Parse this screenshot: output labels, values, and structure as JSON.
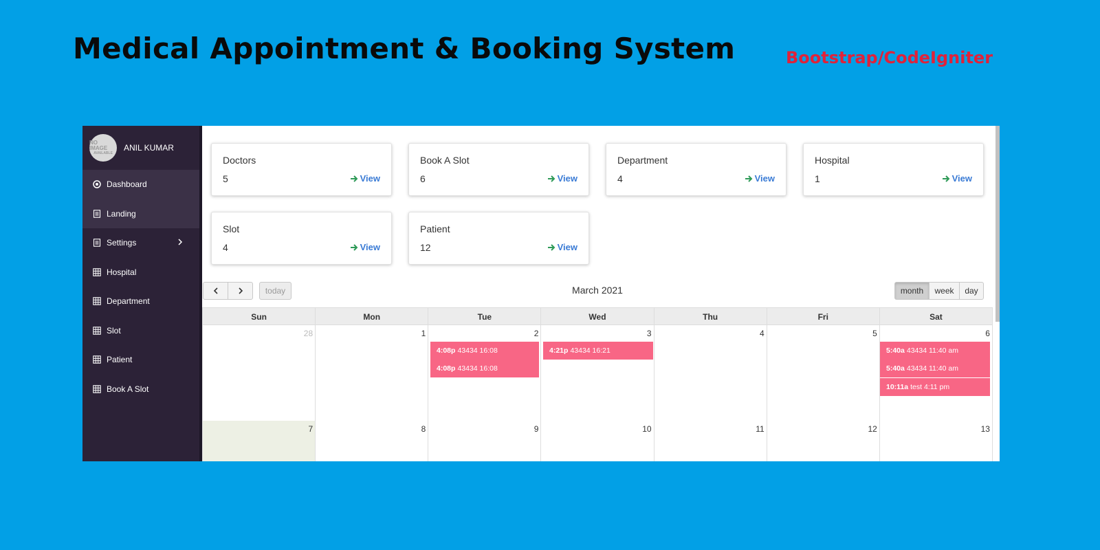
{
  "banner": {
    "title": "Medical Appointment & Booking System",
    "subtitle": "Bootstrap/CodeIgniter"
  },
  "sidebar": {
    "avatar_text": "NO IMAGE",
    "avatar_small": "AVAILABLE",
    "user_name": "ANIL KUMAR",
    "items": [
      {
        "label": "Dashboard",
        "icon": "dashboard-icon"
      },
      {
        "label": "Landing",
        "icon": "document-icon"
      },
      {
        "label": "Settings",
        "icon": "document-icon"
      },
      {
        "label": "Hospital",
        "icon": "table-icon"
      },
      {
        "label": "Department",
        "icon": "table-icon"
      },
      {
        "label": "Slot",
        "icon": "table-icon"
      },
      {
        "label": "Patient",
        "icon": "table-icon"
      },
      {
        "label": "Book A Slot",
        "icon": "table-icon"
      }
    ]
  },
  "cards": [
    {
      "title": "Doctors",
      "value": "5",
      "link": "View"
    },
    {
      "title": "Book A Slot",
      "value": "6",
      "link": "View"
    },
    {
      "title": "Department",
      "value": "4",
      "link": "View"
    },
    {
      "title": "Hospital",
      "value": "1",
      "link": "View"
    },
    {
      "title": "Slot",
      "value": "4",
      "link": "View"
    },
    {
      "title": "Patient",
      "value": "12",
      "link": "View"
    }
  ],
  "calendar": {
    "title": "March 2021",
    "today_label": "today",
    "views": [
      "month",
      "week",
      "day"
    ],
    "selected_view": "month",
    "weekdays": [
      "Sun",
      "Mon",
      "Tue",
      "Wed",
      "Thu",
      "Fri",
      "Sat"
    ],
    "week1": [
      "28",
      "1",
      "2",
      "3",
      "4",
      "5",
      "6"
    ],
    "week2": [
      "7",
      "8",
      "9",
      "10",
      "11",
      "12",
      "13"
    ],
    "events": [
      {
        "time": "4:08p",
        "text": "43434 16:08"
      },
      {
        "time": "4:08p",
        "text": "43434 16:08"
      },
      {
        "time": "4:21p",
        "text": "43434 16:21"
      },
      {
        "time": "5:40a",
        "text": "43434 11:40 am"
      },
      {
        "time": "5:40a",
        "text": "43434 11:40 am"
      },
      {
        "time": "10:11a",
        "text": "test 4:11 pm"
      }
    ]
  },
  "colors": {
    "page_bg": "#02a0e6",
    "sidebar_bg": "#2c2237",
    "event_bg": "#f86685",
    "link": "#3a7bd5",
    "link_arrow": "#2e9a57",
    "subtitle": "#e0223a"
  }
}
